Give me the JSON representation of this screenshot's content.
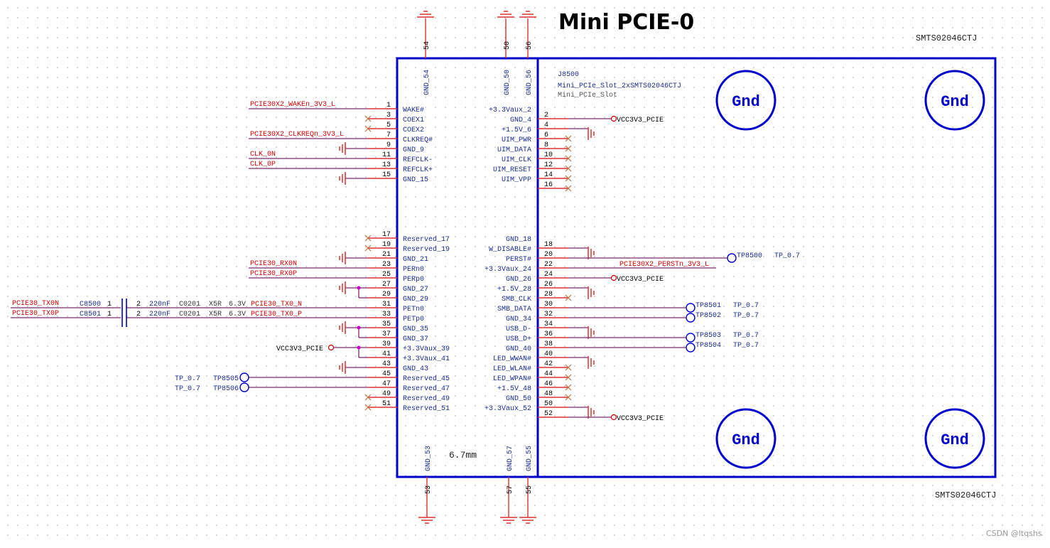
{
  "title": "Mini PCIE-0",
  "watermark": "CSDN @ltqshs",
  "colors": {
    "body": "#0000cc",
    "wire": "#e03030",
    "net": "#cc0000",
    "pinname": "#1a2a8a",
    "junction": "#cc00cc"
  },
  "component": {
    "ref": "J8500",
    "value": "Mini_PCIe_Slot_2xSMTS02046CTJ",
    "footprint_name": "Mini_PCIe_Slot",
    "part_top": "SMTS02046CTJ",
    "part_bottom": "SMTS02046CTJ",
    "height_note": "6.7mm",
    "mount_holes": [
      "Gnd",
      "Gnd",
      "Gnd",
      "Gnd"
    ]
  },
  "top_pins": [
    {
      "num": "54",
      "name": "GND_54"
    },
    {
      "num": "50",
      "name": "GND_50"
    },
    {
      "num": "56",
      "name": "GND_56"
    }
  ],
  "bottom_pins": [
    {
      "num": "53",
      "name": "GND_53"
    },
    {
      "num": "57",
      "name": "GND_57"
    },
    {
      "num": "55",
      "name": "GND_55"
    }
  ],
  "left_pins": [
    {
      "num": "1",
      "name": "WAKE#",
      "net": "PCIE30X2_WAKEn_3V3_L",
      "conn": "net"
    },
    {
      "num": "3",
      "name": "COEX1",
      "conn": "nc"
    },
    {
      "num": "5",
      "name": "COEX2",
      "conn": "nc"
    },
    {
      "num": "7",
      "name": "CLKREQ#",
      "net": "PCIE30X2_CLKREQn_3V3_L",
      "conn": "net"
    },
    {
      "num": "9",
      "name": "GND_9",
      "conn": "gnd"
    },
    {
      "num": "11",
      "name": "REFCLK-",
      "net": "CLK_0N",
      "conn": "net"
    },
    {
      "num": "13",
      "name": "REFCLK+",
      "net": "CLK_0P",
      "conn": "net"
    },
    {
      "num": "15",
      "name": "GND_15",
      "conn": "gnd"
    },
    {
      "num": "17",
      "name": "Reserved_17",
      "conn": "nc"
    },
    {
      "num": "19",
      "name": "Reserved_19",
      "conn": "nc"
    },
    {
      "num": "21",
      "name": "GND_21",
      "conn": "gnd"
    },
    {
      "num": "23",
      "name": "PERn0",
      "net": "PCIE30_RX0N",
      "conn": "net"
    },
    {
      "num": "25",
      "name": "PERp0",
      "net": "PCIE30_RX0P",
      "conn": "net"
    },
    {
      "num": "27",
      "name": "GND_27",
      "conn": "gnd"
    },
    {
      "num": "29",
      "name": "GND_29",
      "conn": "gnd"
    },
    {
      "num": "31",
      "name": "PETn0",
      "net": "PCIE30_TX0_N",
      "conn": "net"
    },
    {
      "num": "33",
      "name": "PETp0",
      "net": "PCIE30_TX0_P",
      "conn": "net"
    },
    {
      "num": "35",
      "name": "GND_35",
      "conn": "gnd"
    },
    {
      "num": "37",
      "name": "GND_37",
      "conn": "gnd"
    },
    {
      "num": "39",
      "name": "+3.3Vaux_39",
      "conn": "pwr"
    },
    {
      "num": "41",
      "name": "+3.3Vaux_41",
      "conn": "pwr"
    },
    {
      "num": "43",
      "name": "GND_43",
      "conn": "gnd"
    },
    {
      "num": "45",
      "name": "Reserved_45",
      "conn": "tp",
      "tp": "TP8505"
    },
    {
      "num": "47",
      "name": "Reserved_47",
      "conn": "tp",
      "tp": "TP8506"
    },
    {
      "num": "49",
      "name": "Reserved_49",
      "conn": "nc"
    },
    {
      "num": "51",
      "name": "Reserved_51",
      "conn": "nc"
    }
  ],
  "right_pins": [
    {
      "num": "2",
      "name": "+3.3Vaux_2",
      "conn": "pwr"
    },
    {
      "num": "4",
      "name": "GND_4",
      "conn": "gnd"
    },
    {
      "num": "6",
      "name": "+1.5V_6",
      "conn": "nc"
    },
    {
      "num": "8",
      "name": "UIM_PWR",
      "conn": "nc"
    },
    {
      "num": "10",
      "name": "UIM_DATA",
      "conn": "nc"
    },
    {
      "num": "12",
      "name": "UIM_CLK",
      "conn": "nc"
    },
    {
      "num": "14",
      "name": "UIM_RESET",
      "conn": "nc"
    },
    {
      "num": "16",
      "name": "UIM_VPP",
      "conn": "nc"
    },
    {
      "num": "18",
      "name": "GND_18",
      "conn": "gnd"
    },
    {
      "num": "20",
      "name": "W_DISABLE#",
      "conn": "tp",
      "tp": "TP8500"
    },
    {
      "num": "22",
      "name": "PERST#",
      "net": "PCIE30X2_PERSTn_3V3_L",
      "conn": "net"
    },
    {
      "num": "24",
      "name": "+3.3Vaux_24",
      "conn": "pwr"
    },
    {
      "num": "26",
      "name": "GND_26",
      "conn": "gnd"
    },
    {
      "num": "28",
      "name": "+1.5V_28",
      "conn": "nc"
    },
    {
      "num": "30",
      "name": "SMB_CLK",
      "conn": "tp",
      "tp": "TP8501"
    },
    {
      "num": "32",
      "name": "SMB_DATA",
      "conn": "tp",
      "tp": "TP8502"
    },
    {
      "num": "34",
      "name": "GND_34",
      "conn": "gnd"
    },
    {
      "num": "36",
      "name": "USB_D-",
      "conn": "tp",
      "tp": "TP8503"
    },
    {
      "num": "38",
      "name": "USB_D+",
      "conn": "tp",
      "tp": "TP8504"
    },
    {
      "num": "40",
      "name": "GND_40",
      "conn": "gnd"
    },
    {
      "num": "42",
      "name": "LED_WWAN#",
      "conn": "nc"
    },
    {
      "num": "44",
      "name": "LED_WLAN#",
      "conn": "nc"
    },
    {
      "num": "46",
      "name": "LED_WPAN#",
      "conn": "nc"
    },
    {
      "num": "48",
      "name": "+1.5V_48",
      "conn": "nc"
    },
    {
      "num": "50",
      "name": "GND_50",
      "conn": "gnd"
    },
    {
      "num": "52",
      "name": "+3.3Vaux_52",
      "conn": "pwr"
    }
  ],
  "power_ports": [
    "VCC3V3_PCIE",
    "VCC3V3_PCIE",
    "VCC3V3_PCIE",
    "VCC3V3_PCIE"
  ],
  "test_points": [
    {
      "ref": "TP8500",
      "value": "TP_0.7"
    },
    {
      "ref": "TP8501",
      "value": "TP_0.7"
    },
    {
      "ref": "TP8502",
      "value": "TP_0.7"
    },
    {
      "ref": "TP8503",
      "value": "TP_0.7"
    },
    {
      "ref": "TP8504",
      "value": "TP_0.7"
    },
    {
      "ref": "TP8505",
      "value": "TP_0.7"
    },
    {
      "ref": "TP8506",
      "value": "TP_0.7"
    }
  ],
  "capacitors": [
    {
      "ref": "C8500",
      "pin1": "1",
      "pin2": "2",
      "value": "220nF",
      "package": "C0201",
      "dielectric": "X5R",
      "voltage": "6.3V",
      "net_in": "PCIE30_TX0N",
      "net_out": "PCIE30_TX0_N"
    },
    {
      "ref": "C8501",
      "pin1": "1",
      "pin2": "2",
      "value": "220nF",
      "package": "C0201",
      "dielectric": "X5R",
      "voltage": "6.3V",
      "net_in": "PCIE30_TX0P",
      "net_out": "PCIE30_TX0_P"
    }
  ]
}
